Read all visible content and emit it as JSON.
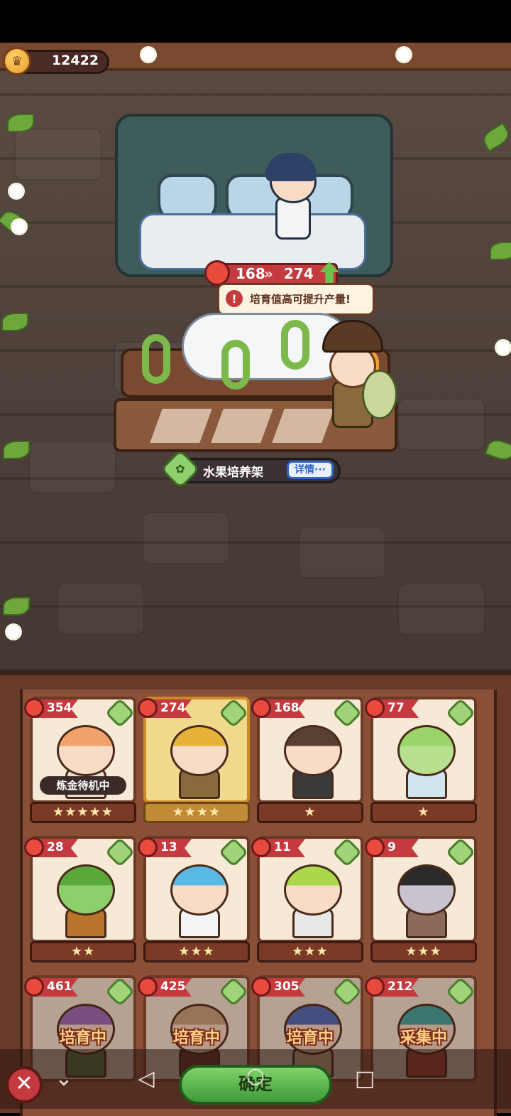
{
  "currency": {
    "value": "12422"
  },
  "station": {
    "stat_current": "168",
    "stat_next": "274",
    "tip": "培育值高可提升产量!",
    "name": "水果培养架",
    "detail_button": "详情···"
  },
  "roster": [
    {
      "value": "354",
      "stars": "★★★★★",
      "status": "炼金待机中",
      "busy_label": "",
      "hair": "#f0a36a",
      "skin": "#f8dcc6",
      "outfit": "#e9e0d0",
      "active": false
    },
    {
      "value": "274",
      "stars": "★★★★",
      "status": "",
      "busy_label": "",
      "hair": "#e6b33a",
      "skin": "#f8dcc6",
      "outfit": "#8a6a3c",
      "active": true
    },
    {
      "value": "168",
      "stars": "★",
      "status": "",
      "busy_label": "",
      "hair": "#5a4030",
      "skin": "#f8dcc6",
      "outfit": "#3a3a3a",
      "active": false
    },
    {
      "value": "77",
      "stars": "★",
      "status": "",
      "busy_label": "",
      "hair": "#9ad46a",
      "skin": "#b7e08f",
      "outfit": "#cfe6f0",
      "active": false
    },
    {
      "value": "28",
      "stars": "★★",
      "status": "",
      "busy_label": "",
      "hair": "#5aa83a",
      "skin": "#8dcf6a",
      "outfit": "#b8742c",
      "active": false
    },
    {
      "value": "13",
      "stars": "★★★",
      "status": "",
      "busy_label": "",
      "hair": "#5ab8e6",
      "skin": "#f8dcc6",
      "outfit": "#f4f4f4",
      "active": false
    },
    {
      "value": "11",
      "stars": "★★★",
      "status": "",
      "busy_label": "",
      "hair": "#a9d84a",
      "skin": "#f8dcc6",
      "outfit": "#e8e8e8",
      "active": false
    },
    {
      "value": "9",
      "stars": "★★★",
      "status": "",
      "busy_label": "",
      "hair": "#2a2a2a",
      "skin": "#c9c3cf",
      "outfit": "#8a6a5a",
      "active": false
    },
    {
      "value": "461",
      "stars": "",
      "status": "",
      "busy_label": "培育中",
      "hair": "#9a6ab8",
      "skin": "#f8dcc6",
      "outfit": "#5a8a4a",
      "active": false
    },
    {
      "value": "425",
      "stars": "",
      "status": "",
      "busy_label": "培育中",
      "hair": "#c9a27a",
      "skin": "#f8dcc6",
      "outfit": "#7a3a2a",
      "active": false
    },
    {
      "value": "305",
      "stars": "",
      "status": "",
      "busy_label": "培育中",
      "hair": "#4a6ab8",
      "skin": "#f8dcc6",
      "outfit": "#e8d0a0",
      "active": false
    },
    {
      "value": "212",
      "stars": "",
      "status": "",
      "busy_label": "采集中",
      "hair": "#3aa8a0",
      "skin": "#f8dcc6",
      "outfit": "#c84a3a",
      "active": false
    }
  ],
  "footer": {
    "confirm": "确定"
  },
  "colors": {
    "accent_red": "#c43a3e",
    "leaf_green": "#9fd479",
    "panel_brown": "#6a3b2a"
  }
}
